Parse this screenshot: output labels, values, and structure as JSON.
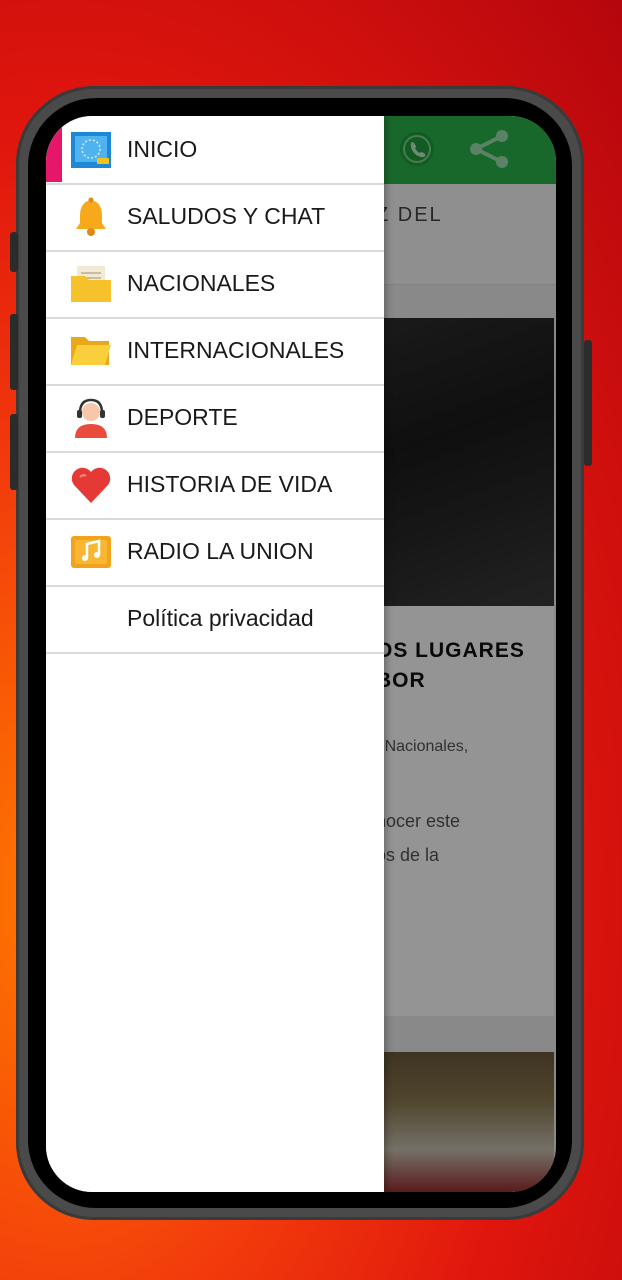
{
  "header": {
    "whatsapp_icon": "whatsapp-icon",
    "share_icon": "share-icon",
    "colors": {
      "header_green": "#2bb34a",
      "accent_pink": "#e6176b"
    }
  },
  "background_app": {
    "subtitle_fragment": "Z DEL",
    "headline_line1": "OS LUGARES",
    "headline_line2": "BOR",
    "meta": "| Nacionales,",
    "body_line1": "nocer este",
    "body_line2": "os de la"
  },
  "drawer": {
    "items": [
      {
        "label": "INICIO",
        "icon": "map-icon"
      },
      {
        "label": "SALUDOS Y CHAT",
        "icon": "bell-icon"
      },
      {
        "label": "NACIONALES",
        "icon": "folder-document-icon"
      },
      {
        "label": "INTERNACIONALES",
        "icon": "open-folder-icon"
      },
      {
        "label": "DEPORTE",
        "icon": "headset-person-icon"
      },
      {
        "label": "HISTORIA DE VIDA",
        "icon": "heart-icon"
      },
      {
        "label": "RADIO LA UNION",
        "icon": "music-note-icon"
      },
      {
        "label": "Política privacidad",
        "icon": ""
      }
    ]
  }
}
